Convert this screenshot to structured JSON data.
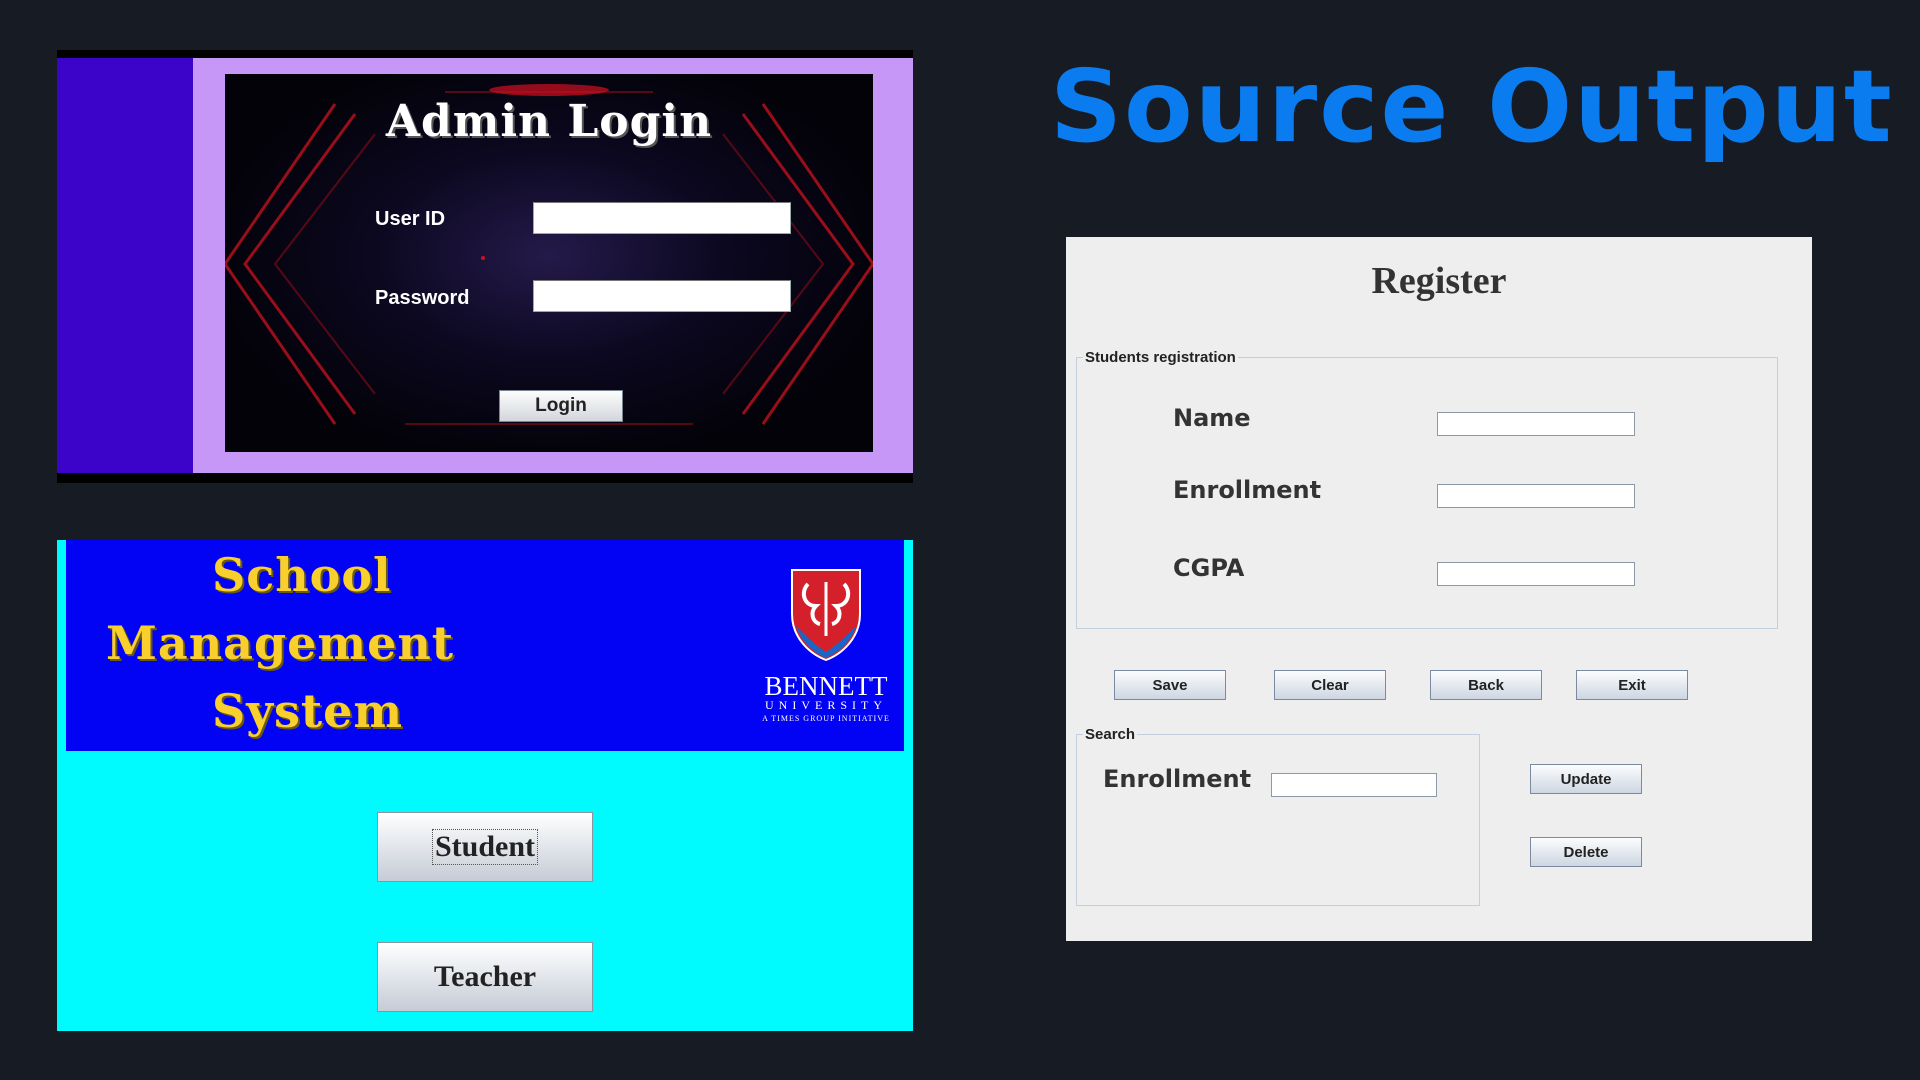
{
  "headline": "Source Output",
  "admin_login": {
    "title": "Admin Login",
    "user_id_label": "User ID",
    "user_id_value": "",
    "password_label": "Password",
    "password_value": "",
    "login_button": "Login"
  },
  "school": {
    "title_lines": [
      "School",
      "Management",
      "System"
    ],
    "university_name": "BENNETT",
    "university_sub": "UNIVERSITY",
    "university_tagline": "A TIMES GROUP INITIATIVE",
    "student_button": "Student",
    "teacher_button": "Teacher"
  },
  "register": {
    "title": "Register",
    "group_label": "Students registration",
    "name_label": "Name",
    "name_value": "",
    "enrollment_label": "Enrollment",
    "enrollment_value": "",
    "cgpa_label": "CGPA",
    "cgpa_value": "",
    "save_button": "Save",
    "clear_button": "Clear",
    "back_button": "Back",
    "exit_button": "Exit",
    "search_group_label": "Search",
    "search_enrollment_label": "Enrollment",
    "search_enrollment_value": "",
    "update_button": "Update",
    "delete_button": "Delete"
  },
  "colors": {
    "background": "#161b24",
    "headline": "#0a7cf0",
    "login_side": "#3b04c8",
    "login_frame": "#c797f7",
    "school_banner": "#0202f4",
    "school_background": "#00fbff",
    "school_title": "#f8cf2c",
    "register_background": "#eeeeee"
  }
}
